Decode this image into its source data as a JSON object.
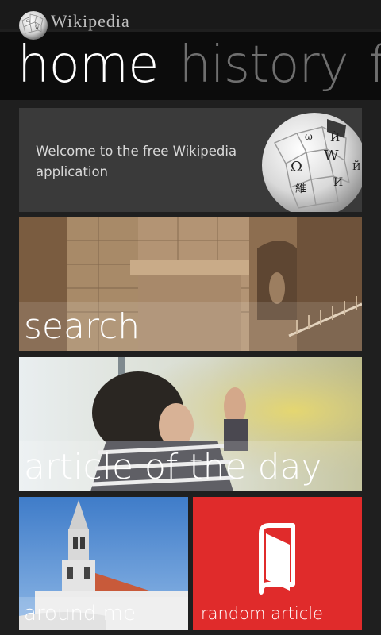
{
  "app": {
    "brand": "Wikipedia"
  },
  "pivot": {
    "tabs": [
      {
        "label": "home",
        "active": true
      },
      {
        "label": "history",
        "active": false
      },
      {
        "label": "favorites",
        "active": false
      }
    ]
  },
  "tiles": {
    "welcome": {
      "text": "Welcome to the free Wikipedia application",
      "icon": "wikipedia-globe-icon"
    },
    "search": {
      "label": "search",
      "image": "stone-hall-photo"
    },
    "article_of_the_day": {
      "label": "article of the day",
      "image": "child-at-window-photo"
    },
    "around_me": {
      "label": "around me",
      "image": "church-tower-photo"
    },
    "random_article": {
      "label": "random article",
      "icon": "book-icon",
      "color": "#E02B2B"
    }
  },
  "colors": {
    "background": "#1F1F1F",
    "header": "#0C0C0C",
    "tile_dark": "#3A3A3A",
    "accent_red": "#E02B2B"
  }
}
